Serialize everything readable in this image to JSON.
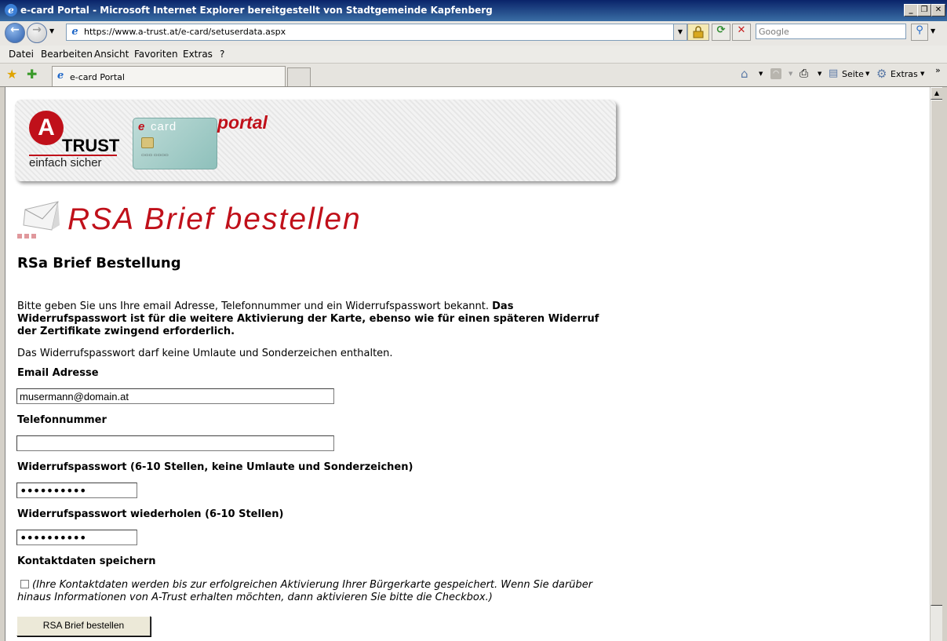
{
  "window": {
    "title": "e-card Portal - Microsoft Internet Explorer bereitgestellt von Stadtgemeinde Kapfenberg",
    "minimize": "_",
    "restore": "❐",
    "close": "✕"
  },
  "toolbar": {
    "url": "https://www.a-trust.at/e-card/setuserdata.aspx",
    "search_placeholder": "Google"
  },
  "menu": {
    "items": [
      "Datei",
      "Bearbeiten",
      "Ansicht",
      "Favoriten",
      "Extras",
      "?"
    ]
  },
  "tabs": {
    "active_tab": "e-card Portal",
    "commands": {
      "page": "Seite",
      "tools": "Extras"
    }
  },
  "banner": {
    "brand": "TRUST",
    "brand_letter": "A",
    "tagline": "einfach sicher",
    "card_label_e": "e",
    "card_label": "card",
    "portal": "portal"
  },
  "page": {
    "banner_title": "RSA Brief bestellen",
    "heading": "RSa Brief Bestellung",
    "intro_plain": "Bitte geben Sie uns Ihre email Adresse, Telefonnummer und ein Widerrufspasswort bekannt. ",
    "intro_bold": "Das Widerrufspasswort ist für die weitere Aktivierung der Karte, ebenso wie für einen späteren Widerruf der Zertifikate zwingend erforderlich.",
    "password_note": "Das Widerrufspasswort darf keine Umlaute und Sonderzeichen enthalten."
  },
  "form": {
    "email_label": "Email Adresse",
    "email_value": "musermann@domain.at",
    "phone_label": "Telefonnummer",
    "phone_value": "",
    "pw_label": "Widerrufspasswort (6-10 Stellen, keine Umlaute und Sonderzeichen)",
    "pw_value_masked": "••••••••••",
    "pw2_label": "Widerrufspasswort wiederholen (6-10 Stellen)",
    "pw2_value_masked": "••••••••••",
    "save_label": "Kontaktdaten speichern",
    "save_checked": false,
    "save_text": "(Ihre Kontaktdaten werden bis zur erfolgreichen Aktivierung Ihrer Bürgerkarte gespeichert. Wenn Sie darüber hinaus Informationen von A-Trust erhalten möchten, dann aktivieren Sie bitte die Checkbox.)",
    "submit_label": "RSA Brief bestellen"
  },
  "colors": {
    "brand_red": "#c0101a",
    "titlebar": "#0a246a"
  }
}
